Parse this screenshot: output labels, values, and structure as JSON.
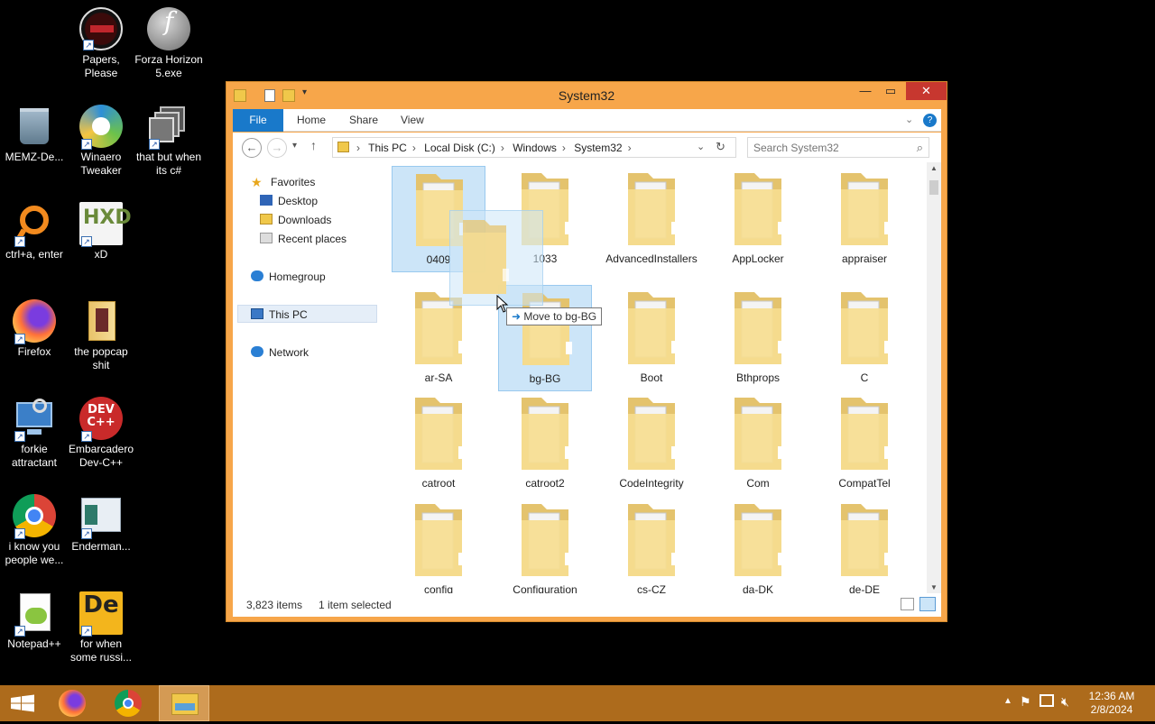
{
  "desktop": {
    "icons": [
      {
        "label": "Papers, Please",
        "icon": "papers-please-icon"
      },
      {
        "label": "Forza Horizon 5.exe",
        "icon": "flash-icon"
      },
      {
        "label": "MEMZ-De...",
        "icon": "recycle-bin-icon"
      },
      {
        "label": "Winaero Tweaker",
        "icon": "winaero-icon"
      },
      {
        "label": "that but when its c#",
        "icon": "stack-icon"
      },
      {
        "label": "ctrl+a, enter",
        "icon": "ring-icon"
      },
      {
        "label": "xD",
        "icon": "hxd-icon"
      },
      {
        "label": "Firefox",
        "icon": "firefox-icon"
      },
      {
        "label": "the popcap shit",
        "icon": "folder-icon"
      },
      {
        "label": "forkie attractant",
        "icon": "network-settings-icon"
      },
      {
        "label": "Embarcadero Dev-C++",
        "icon": "devcpp-icon"
      },
      {
        "label": "i know you people we...",
        "icon": "chrome-icon"
      },
      {
        "label": "Enderman...",
        "icon": "app-window-icon"
      },
      {
        "label": "Notepad++",
        "icon": "notepadpp-icon"
      },
      {
        "label": "for when some russi...",
        "icon": "de-icon"
      }
    ]
  },
  "window": {
    "title": "System32",
    "ribbon_tabs": [
      "File",
      "Home",
      "Share",
      "View"
    ],
    "breadcrumb": [
      "This PC",
      "Local Disk (C:)",
      "Windows",
      "System32"
    ],
    "search_placeholder": "Search System32",
    "nav": {
      "favorites": "Favorites",
      "desktop": "Desktop",
      "downloads": "Downloads",
      "recent": "Recent places",
      "homegroup": "Homegroup",
      "thispc": "This PC",
      "network": "Network"
    },
    "folders": [
      {
        "name": "0409"
      },
      {
        "name": "1033"
      },
      {
        "name": "AdvancedInstallers"
      },
      {
        "name": "AppLocker"
      },
      {
        "name": "appraiser"
      },
      {
        "name": "ar-SA"
      },
      {
        "name": "bg-BG"
      },
      {
        "name": "Boot"
      },
      {
        "name": "Bthprops"
      },
      {
        "name": "C"
      },
      {
        "name": "catroot"
      },
      {
        "name": "catroot2"
      },
      {
        "name": "CodeIntegrity"
      },
      {
        "name": "Com"
      },
      {
        "name": "CompatTel"
      },
      {
        "name": "config"
      },
      {
        "name": "Configuration"
      },
      {
        "name": "cs-CZ"
      },
      {
        "name": "da-DK"
      },
      {
        "name": "de-DE"
      }
    ],
    "drag_tooltip": "Move to bg-BG",
    "status": {
      "count": "3,823 items",
      "selected": "1 item selected"
    }
  },
  "taskbar": {
    "clock_time": "12:36 AM",
    "clock_date": "2/8/2024"
  },
  "colors": {
    "window_frame": "#f7a64a",
    "taskbar": "#ad6b1c",
    "file_tab": "#1979ca",
    "close": "#c7372f",
    "selection": "#cce5f8"
  }
}
